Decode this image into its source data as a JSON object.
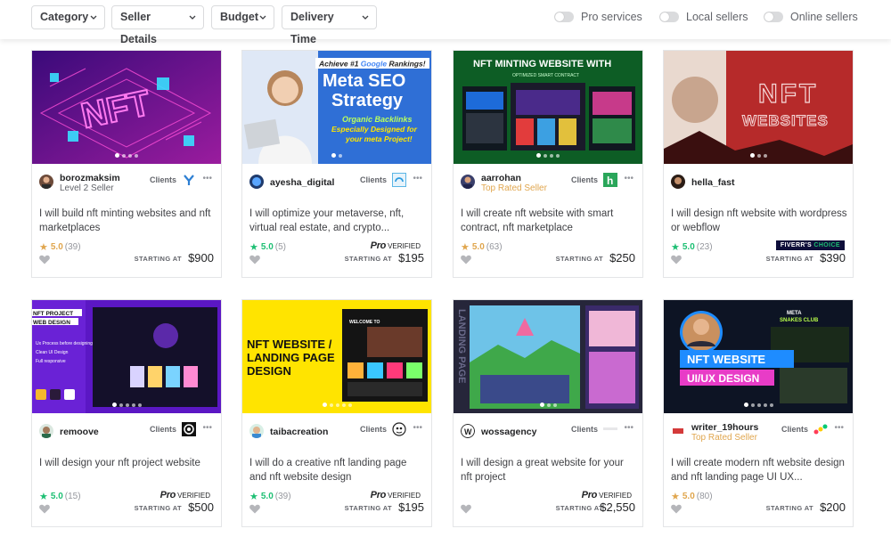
{
  "filters": {
    "dropdowns": [
      "Category",
      "Seller Details",
      "Budget",
      "Delivery Time"
    ],
    "toggles": [
      "Pro services",
      "Local sellers",
      "Online sellers"
    ]
  },
  "labels": {
    "clients": "Clients",
    "starting_at": "STARTING AT",
    "pro": "Pro",
    "verified": "VERIFIED",
    "fiverrs": "FIVERR'S",
    "choice": "CHOICE"
  },
  "cards": [
    {
      "seller": "borozmaksim",
      "level": "Level 2 Seller",
      "clients": true,
      "title": "I will build nft minting websites and nft marketplaces",
      "rating": "5.0",
      "reviews": "(39)",
      "badge": "",
      "price": "$900",
      "thumb_text": "NFT"
    },
    {
      "seller": "ayesha_digital",
      "level": "",
      "clients": true,
      "title": "I will optimize your metaverse, nft, virtual real estate, and crypto...",
      "rating": "5.0",
      "reviews": "(5)",
      "badge": "pro",
      "price": "$195",
      "thumb_text": "Meta SEO Strategy"
    },
    {
      "seller": "aarrohan",
      "level": "Top Rated Seller",
      "clients": true,
      "title": "I will create nft website with smart contract, nft marketplace",
      "rating": "5.0",
      "reviews": "(63)",
      "badge": "",
      "price": "$250",
      "thumb_text": "NFT MINTING WEBSITE WITH"
    },
    {
      "seller": "hella_fast",
      "level": "",
      "clients": false,
      "title": "I will design nft website with wordpress or webflow",
      "rating": "5.0",
      "reviews": "(23)",
      "badge": "choice",
      "price": "$390",
      "thumb_text": "NFT WEBSITES"
    },
    {
      "seller": "remoove",
      "level": "",
      "clients": true,
      "title": "I will design your nft project website",
      "rating": "5.0",
      "reviews": "(15)",
      "badge": "pro",
      "price": "$500",
      "thumb_text": "NFT PROJECT WEB DESIGN"
    },
    {
      "seller": "taibacreation",
      "level": "",
      "clients": true,
      "title": "I will do a creative nft landing page and nft website design",
      "rating": "5.0",
      "reviews": "(39)",
      "badge": "pro",
      "price": "$195",
      "thumb_text": "NFT WEBSITE / LANDING PAGE DESIGN"
    },
    {
      "seller": "wossagency",
      "level": "",
      "clients": true,
      "title": "I will design a great website for your nft project",
      "rating": "",
      "reviews": "",
      "badge": "pro",
      "price": "$2,550",
      "thumb_text": "LANDING PAGE"
    },
    {
      "seller": "writer_19hours",
      "level": "Top Rated Seller",
      "clients": true,
      "title": "I will create modern nft website design and nft landing page UI UX...",
      "rating": "5.0",
      "reviews": "(80)",
      "badge": "",
      "price": "$200",
      "thumb_text": "NFT WEBSITE UI/UX DESIGN"
    }
  ],
  "thumb_texts": {
    "c0": "NFT",
    "c1_banner": "Achieve #1",
    "c1_google": "Google",
    "c1_rank": "Rankings!",
    "c1_title1": "Meta SEO",
    "c1_title2": "Strategy",
    "c1_sub1": "Organic Backlinks",
    "c1_sub2": "Especially Designed for",
    "c1_sub3": "your meta Project!",
    "c2_title": "NFT MINTING WEBSITE WITH",
    "c2_sub": "OPTIMIZED SMART CONTRACT",
    "c3_1": "NFT",
    "c3_2": "WEBSITES",
    "c4_1": "NFT PROJECT",
    "c4_2": "WEB DESIGN",
    "c4_l1": "Ux Process before designing",
    "c4_l2": "Clean UI Design",
    "c4_l3": "Full responsive",
    "c5_1": "NFT WEBSITE /",
    "c5_2": "LANDING PAGE",
    "c5_3": "DESIGN",
    "c5_banner": "WELCOME TO",
    "c6_side": "LANDING PAGE",
    "c7_1": "NFT WEBSITE",
    "c7_2": "UI/UX DESIGN",
    "c7_top": "META",
    "c7_top2": "SNAKES CLUB"
  },
  "colors": {
    "green": "#1dbf73",
    "gold": "#e0a64e",
    "purple": "#6a1ccf",
    "yellow": "#ffe400",
    "red": "#b92b2b"
  }
}
